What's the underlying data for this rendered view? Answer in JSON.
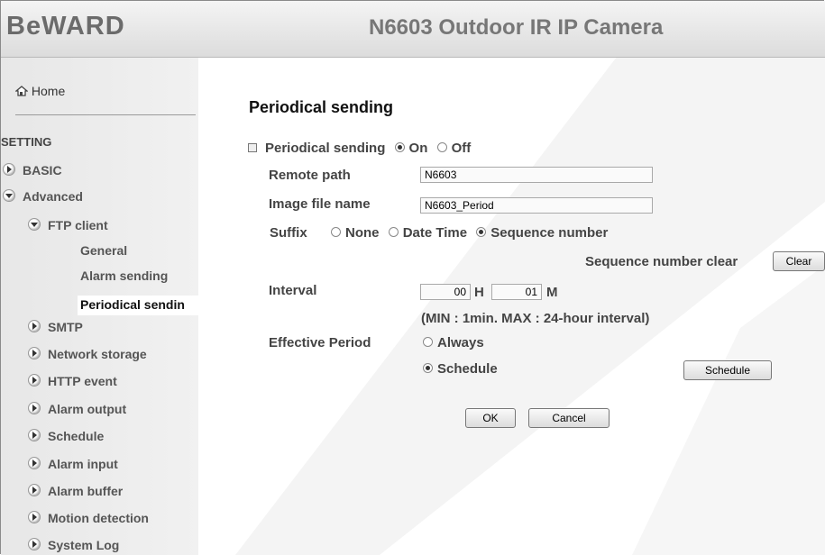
{
  "header": {
    "logo": "BeWARD",
    "camera_title": "N6603 Outdoor IR IP Camera"
  },
  "sidebar": {
    "home": "Home",
    "setting": "SETTING",
    "items": [
      {
        "label": "BASIC",
        "expanded": false
      },
      {
        "label": "Advanced",
        "expanded": true
      },
      {
        "label": "FTP client",
        "expanded": true
      },
      {
        "label": "General"
      },
      {
        "label": "Alarm sending"
      },
      {
        "label": "Periodical sendin",
        "active": true
      },
      {
        "label": "SMTP",
        "expanded": false
      },
      {
        "label": "Network storage",
        "expanded": false
      },
      {
        "label": "HTTP event",
        "expanded": false
      },
      {
        "label": "Alarm output",
        "expanded": false
      },
      {
        "label": "Schedule",
        "expanded": false
      },
      {
        "label": "Alarm input",
        "expanded": false
      },
      {
        "label": "Alarm buffer",
        "expanded": false
      },
      {
        "label": "Motion detection",
        "expanded": false
      },
      {
        "label": "System Log",
        "expanded": false
      }
    ]
  },
  "main": {
    "title": "Periodical sending",
    "periodical_label": "Periodical sending",
    "on_label": "On",
    "off_label": "Off",
    "periodical_value": "On",
    "remote_path_label": "Remote path",
    "remote_path_value": "N6603",
    "image_file_label": "Image file name",
    "image_file_value": "N6603_Period",
    "suffix_label": "Suffix",
    "suffix_options": [
      "None",
      "Date Time",
      "Sequence number"
    ],
    "suffix_value": "Sequence number",
    "seq_clear_label": "Sequence number clear",
    "clear_button": "Clear",
    "interval_label": "Interval",
    "interval_h_value": "00",
    "interval_h_unit": "H",
    "interval_m_value": "01",
    "interval_m_unit": "M",
    "interval_note": "(MIN : 1min. MAX : 24-hour interval)",
    "effective_label": "Effective Period",
    "always_label": "Always",
    "schedule_label": "Schedule",
    "effective_value": "Schedule",
    "schedule_button": "Schedule",
    "ok_button": "OK",
    "cancel_button": "Cancel"
  }
}
